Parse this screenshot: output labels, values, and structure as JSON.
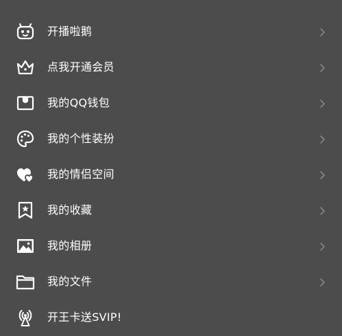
{
  "colors": {
    "background": "#4c4c4c",
    "text": "#ffffff",
    "chevron": "#8e8e8e"
  },
  "menu": {
    "items": [
      {
        "label": "开播啦鹅",
        "icon": "robot-penguin-icon",
        "has_chevron": true
      },
      {
        "label": "点我开通会员",
        "icon": "crown-icon",
        "has_chevron": true
      },
      {
        "label": "我的QQ钱包",
        "icon": "wallet-icon",
        "has_chevron": true
      },
      {
        "label": "我的个性装扮",
        "icon": "palette-icon",
        "has_chevron": true
      },
      {
        "label": "我的情侣空间",
        "icon": "double-heart-icon",
        "has_chevron": true
      },
      {
        "label": "我的收藏",
        "icon": "bookmark-star-icon",
        "has_chevron": true
      },
      {
        "label": "我的相册",
        "icon": "photo-album-icon",
        "has_chevron": true
      },
      {
        "label": "我的文件",
        "icon": "folder-icon",
        "has_chevron": true
      },
      {
        "label": "开王卡送SVIP!",
        "icon": "broadcast-antenna-icon",
        "has_chevron": false
      }
    ]
  }
}
